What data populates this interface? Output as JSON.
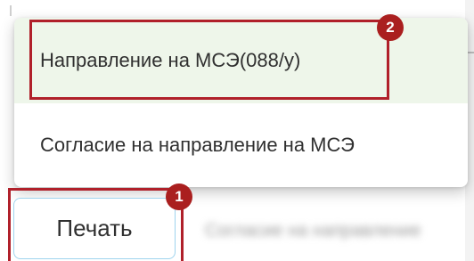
{
  "menu": {
    "items": [
      {
        "label": "Направление на МСЭ(088/у)",
        "state": "hover"
      },
      {
        "label": "Согласие на направление на МСЭ"
      }
    ]
  },
  "toolbar": {
    "print_label": "Печать",
    "blurred_label": "Согласие на направление"
  },
  "annotations": {
    "step_1": "1",
    "step_2": "2",
    "highlight_color": "#b0202a"
  },
  "colors": {
    "hover_background": "#eef6ea",
    "button_border": "#9fd4ee",
    "badge_background": "#aa1f1f"
  }
}
